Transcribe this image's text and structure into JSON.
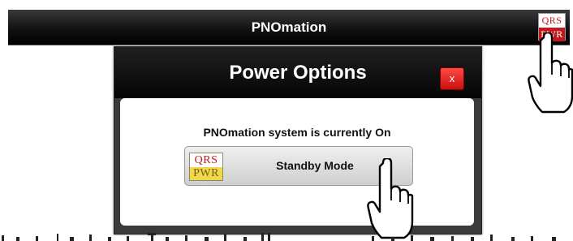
{
  "app": {
    "title": "PNOmation"
  },
  "logo": {
    "top": "QRS",
    "bottom": "PWR"
  },
  "dialog": {
    "title": "Power Options",
    "close_label": "x",
    "status": "PNOmation system is currently On",
    "standby_label": "Standby Mode"
  },
  "icons": [
    "qrs-pwr-logo-icon",
    "close-icon",
    "pointing-hand-icon"
  ],
  "colors": {
    "bar": "#000000",
    "close": "#e0201b",
    "logo_red": "#c0181e",
    "logo_yellow": "#f0d84a"
  }
}
